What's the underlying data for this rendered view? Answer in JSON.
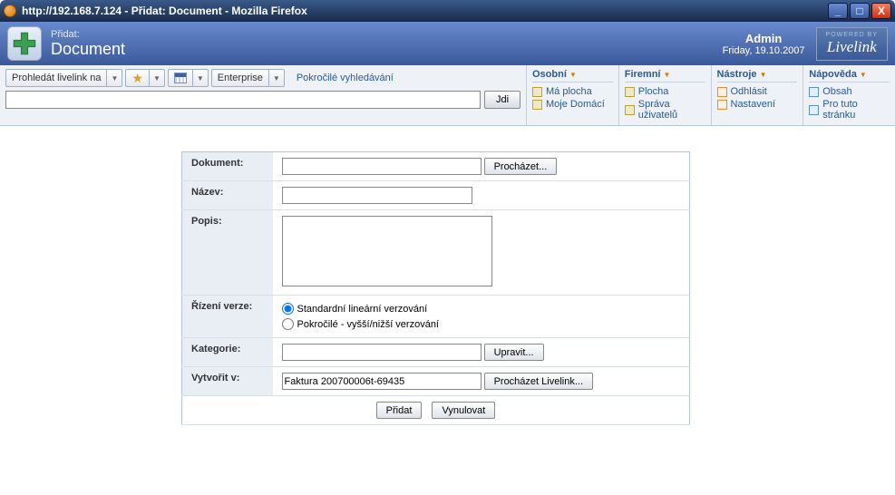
{
  "window": {
    "title": "http://192.168.7.124 - Přidat: Document - Mozilla Firefox"
  },
  "header": {
    "subtitle": "Přidat:",
    "title": "Document",
    "user_name": "Admin",
    "user_date": "Friday, 19.10.2007",
    "logo_small": "POWERED BY",
    "logo_big": "Livelink"
  },
  "toolbar": {
    "search_scope": "Prohledát livelink na",
    "enterprise": "Enterprise",
    "advanced": "Pokročilé vyhledávání",
    "go": "Jdi",
    "search_value": ""
  },
  "nav": {
    "cols": [
      {
        "title": "Osobní",
        "links": [
          {
            "icon": "doc",
            "label": "Má plocha"
          },
          {
            "icon": "doc",
            "label": "Moje Domácí"
          }
        ]
      },
      {
        "title": "Firemní",
        "links": [
          {
            "icon": "doc",
            "label": "Plocha"
          },
          {
            "icon": "doc",
            "label": "Správa uživatelů"
          }
        ]
      },
      {
        "title": "Nástroje",
        "links": [
          {
            "icon": "x",
            "label": "Odhlásit"
          },
          {
            "icon": "x",
            "label": "Nastavení"
          }
        ]
      },
      {
        "title": "Nápověda",
        "links": [
          {
            "icon": "list",
            "label": "Obsah"
          },
          {
            "icon": "list",
            "label": "Pro tuto stránku"
          }
        ]
      }
    ]
  },
  "form": {
    "labels": {
      "dokument": "Dokument:",
      "nazev": "Název:",
      "popis": "Popis:",
      "verze": "Řízení verze:",
      "kategorie": "Kategorie:",
      "vytvorit": "Vytvořit v:"
    },
    "dokument_value": "",
    "browse": "Procházet...",
    "nazev_value": "",
    "popis_value": "",
    "verze_standard": "Standardní lineární verzování",
    "verze_advanced": "Pokročilé - vyšší/nižší verzování",
    "kategorie_value": "",
    "upravit": "Upravit...",
    "vytvorit_value": "Faktura 200700006t-69435",
    "browse_livelink": "Procházet Livelink...",
    "submit": "Přidat",
    "reset": "Vynulovat"
  }
}
